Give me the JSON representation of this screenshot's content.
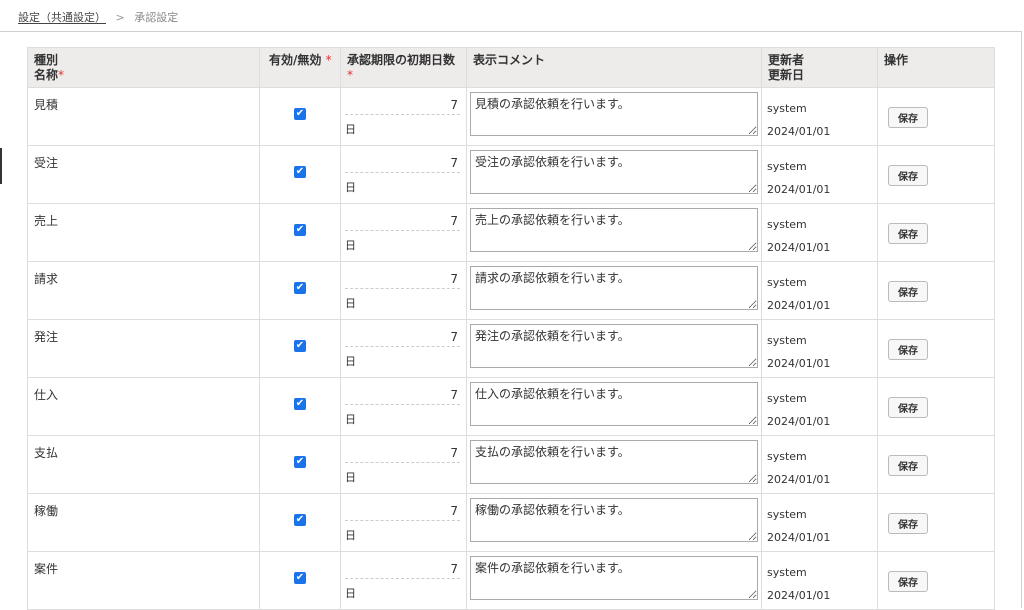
{
  "breadcrumb": {
    "parent": "設定（共通設定）",
    "separator": ">",
    "current": "承認設定"
  },
  "headers": {
    "type_line1": "種別",
    "type_line2": "名称",
    "required_mark": "*",
    "enabled": "有効/無効",
    "days": "承認期限の初期日数",
    "comment": "表示コメント",
    "updater_line1": "更新者",
    "updater_line2": "更新日",
    "operation": "操作"
  },
  "day_unit": "日",
  "save_label": "保存",
  "rows": [
    {
      "name": "見積",
      "enabled": true,
      "days": "7",
      "comment": "見積の承認依頼を行います。",
      "updated_by": "system",
      "updated_at": "2024/01/01"
    },
    {
      "name": "受注",
      "enabled": true,
      "days": "7",
      "comment": "受注の承認依頼を行います。",
      "updated_by": "system",
      "updated_at": "2024/01/01"
    },
    {
      "name": "売上",
      "enabled": true,
      "days": "7",
      "comment": "売上の承認依頼を行います。",
      "updated_by": "system",
      "updated_at": "2024/01/01"
    },
    {
      "name": "請求",
      "enabled": true,
      "days": "7",
      "comment": "請求の承認依頼を行います。",
      "updated_by": "system",
      "updated_at": "2024/01/01"
    },
    {
      "name": "発注",
      "enabled": true,
      "days": "7",
      "comment": "発注の承認依頼を行います。",
      "updated_by": "system",
      "updated_at": "2024/01/01"
    },
    {
      "name": "仕入",
      "enabled": true,
      "days": "7",
      "comment": "仕入の承認依頼を行います。",
      "updated_by": "system",
      "updated_at": "2024/01/01"
    },
    {
      "name": "支払",
      "enabled": true,
      "days": "7",
      "comment": "支払の承認依頼を行います。",
      "updated_by": "system",
      "updated_at": "2024/01/01"
    },
    {
      "name": "稼働",
      "enabled": true,
      "days": "7",
      "comment": "稼働の承認依頼を行います。",
      "updated_by": "system",
      "updated_at": "2024/01/01"
    },
    {
      "name": "案件",
      "enabled": true,
      "days": "7",
      "comment": "案件の承認依頼を行います。",
      "updated_by": "system",
      "updated_at": "2024/01/01"
    }
  ],
  "colors": {
    "checkbox": "#1a73e8",
    "header_bg": "#eeeceb",
    "required": "#dd3333"
  },
  "icons": {
    "checkbox": "checkmark-icon"
  }
}
